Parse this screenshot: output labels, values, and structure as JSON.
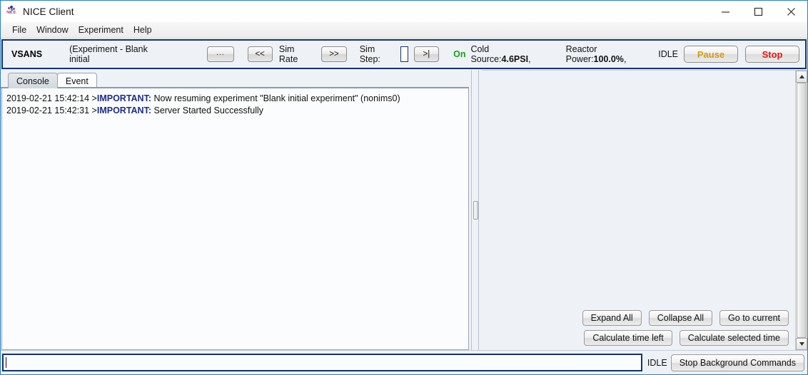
{
  "window": {
    "title": "NICE Client",
    "icon": "nice-logo-icon",
    "controls": {
      "minimize": "minimize-icon",
      "maximize": "maximize-icon",
      "close": "close-icon"
    }
  },
  "menubar": {
    "items": [
      {
        "label": "File"
      },
      {
        "label": "Window"
      },
      {
        "label": "Experiment"
      },
      {
        "label": "Help"
      }
    ]
  },
  "toolbar": {
    "instrument": "VSANS",
    "experiment_label": "(Experiment - Blank initial",
    "browse_button": "...",
    "back_button": "<<",
    "sim_rate_label": "Sim Rate",
    "forward_button": ">>",
    "sim_step_label": "Sim Step:",
    "sim_step_value": "",
    "step_button": ">|",
    "cold_source_state": "On",
    "cold_source_label": "Cold Source:",
    "cold_source_value": "4.6PSI",
    "cold_source_sep": ",",
    "reactor_power_label": "Reactor Power:",
    "reactor_power_value": "100.0%",
    "reactor_power_sep": ",",
    "status": "IDLE",
    "pause_button": "Pause",
    "stop_button": "Stop",
    "colors": {
      "border": "#14346b",
      "on_green": "#16a114",
      "pause_amber": "#d79a16",
      "stop_red": "#ee1111"
    }
  },
  "left_panel": {
    "tabs": [
      {
        "label": "Console",
        "active": true
      },
      {
        "label": "Event",
        "active": false
      }
    ],
    "console_lines": [
      {
        "timestamp": "2019-02-21 15:42:14 >",
        "level": "IMPORTANT:",
        "message": "Now resuming experiment \"Blank initial experiment\" (nonims0)"
      },
      {
        "timestamp": "2019-02-21 15:42:31 >",
        "level": "IMPORTANT:",
        "message": "Server Started Successfully"
      }
    ],
    "level_color": "#1b2f86"
  },
  "right_panel": {
    "buttons_row1": [
      {
        "label": "Expand All"
      },
      {
        "label": "Collapse All"
      },
      {
        "label": "Go to current"
      }
    ],
    "buttons_row2": [
      {
        "label": "Calculate time left"
      },
      {
        "label": "Calculate selected time"
      }
    ],
    "scrollbar": {
      "up": "scroll-up-arrow-icon",
      "down": "scroll-down-arrow-icon"
    }
  },
  "command_bar": {
    "input_value": "",
    "status": "IDLE",
    "stop_background_button": "Stop Background Commands"
  }
}
